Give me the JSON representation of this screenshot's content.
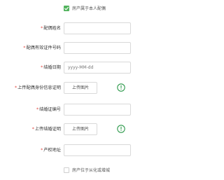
{
  "owner_check": {
    "label": "房产属于本人配偶",
    "checked": true
  },
  "fields": [
    {
      "label": "配偶姓名",
      "required": true,
      "type": "text",
      "value": "",
      "placeholder": ""
    },
    {
      "label": "配偶有效证件号码",
      "required": true,
      "type": "text",
      "value": "",
      "placeholder": ""
    },
    {
      "label": "结婚日期",
      "required": true,
      "type": "date",
      "value": "",
      "placeholder": "yyyy-MM-dd"
    },
    {
      "label": "上传配偶身份信息证明",
      "required": true,
      "type": "upload",
      "button_label": "上传图片",
      "icon": "info-circle-icon"
    },
    {
      "label": "结婚证编号",
      "required": true,
      "type": "text",
      "value": "",
      "placeholder": ""
    },
    {
      "label": "上传结婚证明",
      "required": true,
      "type": "upload",
      "button_label": "上传图片",
      "icon": "info-circle-icon"
    },
    {
      "label": "产权地址",
      "required": true,
      "type": "text",
      "value": "",
      "placeholder": ""
    }
  ],
  "location_check": {
    "label": "房产位于从化或增城",
    "checked": false
  },
  "colors": {
    "accent": "#52b35d",
    "required_star": "#e0453d",
    "info_icon": "#2f9a4d",
    "border": "#d9d9d9"
  }
}
